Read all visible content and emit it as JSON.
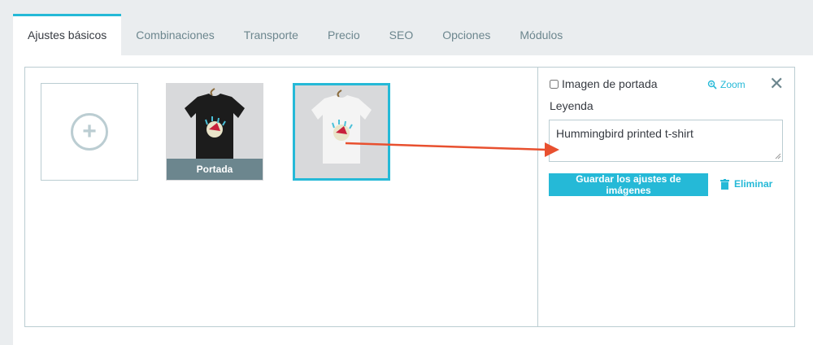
{
  "tabs": [
    {
      "label": "Ajustes básicos",
      "active": true
    },
    {
      "label": "Combinaciones"
    },
    {
      "label": "Transporte"
    },
    {
      "label": "Precio"
    },
    {
      "label": "SEO"
    },
    {
      "label": "Opciones"
    },
    {
      "label": "Módulos"
    }
  ],
  "images": {
    "add_icon": "plus-circle-icon",
    "thumb1": {
      "shirt_color": "#1c1c1c",
      "label": "Portada"
    },
    "thumb2": {
      "shirt_color": "#f4f4f4",
      "selected": true
    }
  },
  "sidebar": {
    "cover_checkbox_label": "Imagen de portada",
    "cover_checked": false,
    "zoom_label": "Zoom",
    "legend_label": "Leyenda",
    "caption_value": "Hummingbird printed t-shirt",
    "save_label": "Guardar los ajustes de imágenes",
    "delete_label": "Eliminar"
  },
  "colors": {
    "accent": "#25b9d7",
    "annotation_arrow": "#e8502f"
  }
}
